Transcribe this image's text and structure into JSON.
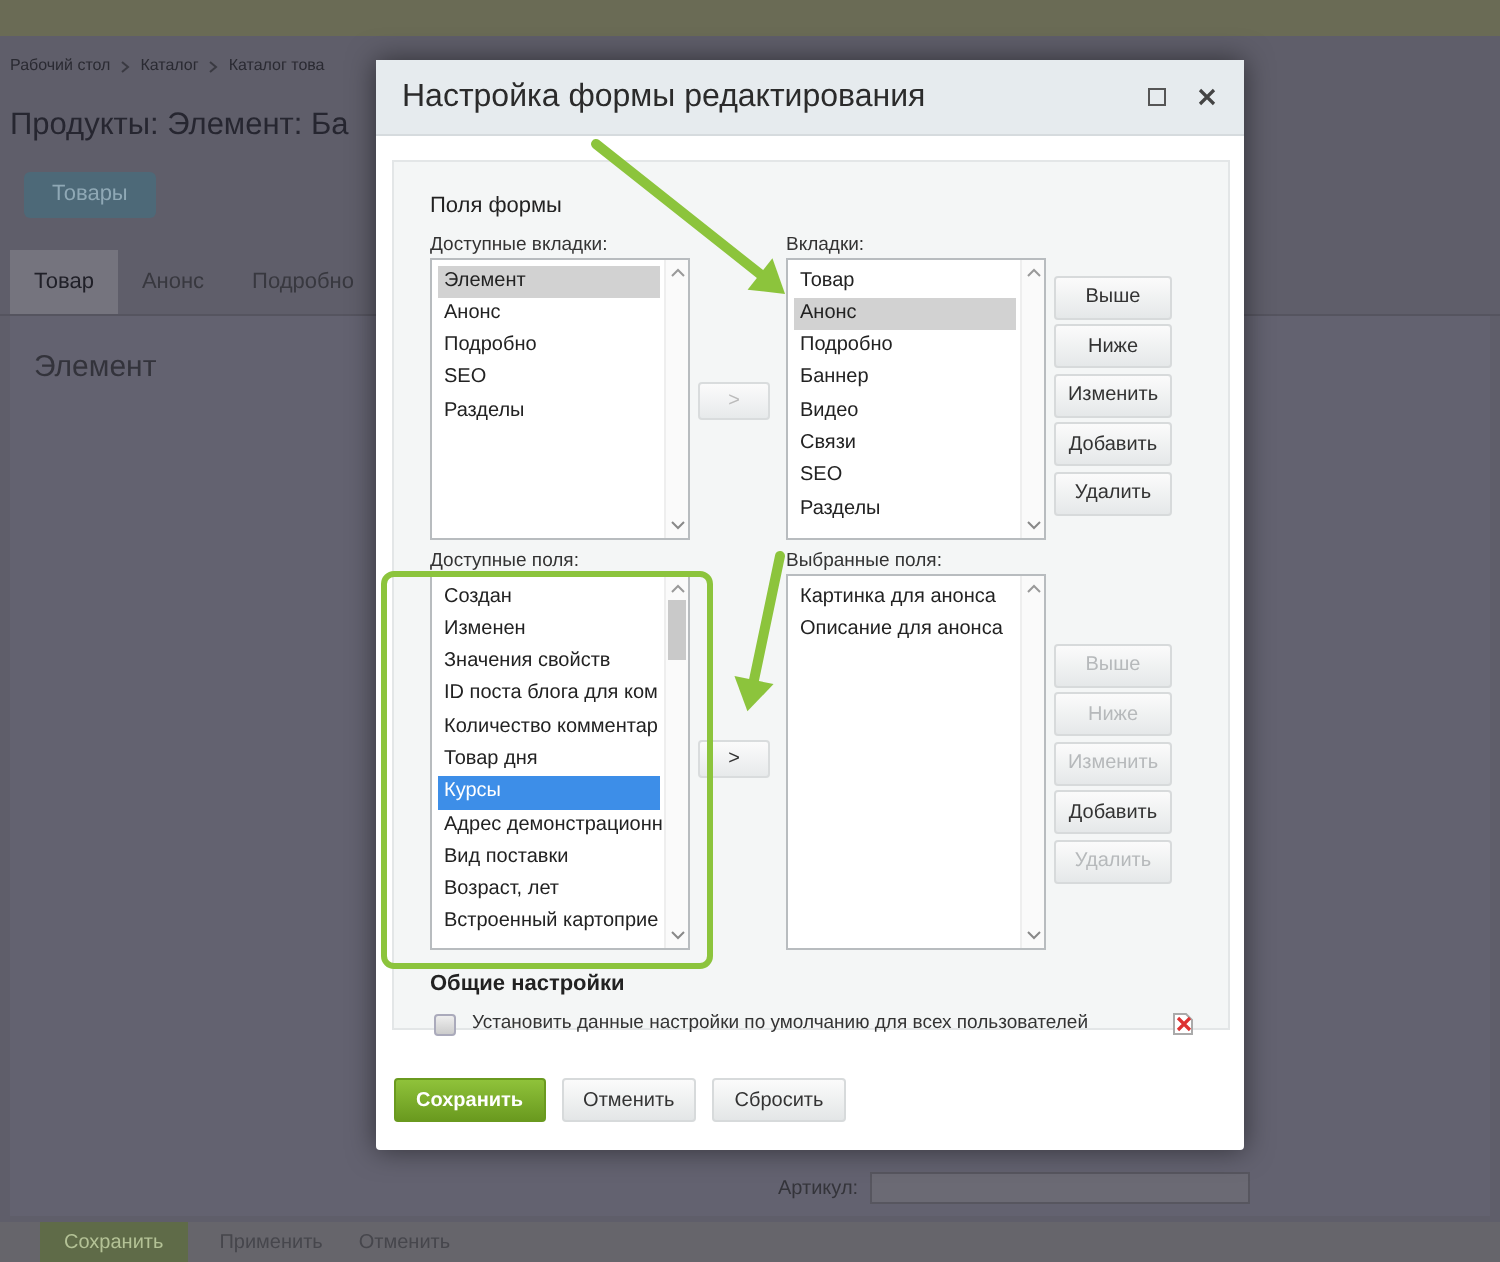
{
  "page": {
    "breadcrumbs": [
      "Рабочий стол",
      "Каталог",
      "Каталог това"
    ],
    "title": "Продукты: Элемент: Ба",
    "back_button": "Товары",
    "tabs": [
      {
        "label": "Товар",
        "selected": true
      },
      {
        "label": "Анонс",
        "selected": false
      },
      {
        "label": "Подробно",
        "selected": false
      }
    ],
    "section_title": "Элемент",
    "field_label": "Артикул:",
    "footer_buttons": [
      {
        "label": "Сохранить",
        "kind": "primary"
      },
      {
        "label": "Применить",
        "kind": "plain"
      },
      {
        "label": "Отменить",
        "kind": "plain"
      }
    ]
  },
  "dialog": {
    "title": "Настройка формы редактирования",
    "section_title": "Поля формы",
    "tab_lists": {
      "available_label": "Доступные вкладки:",
      "available": [
        {
          "label": "Элемент",
          "selected": true
        },
        {
          "label": "Анонс",
          "selected": false
        },
        {
          "label": "Подробно",
          "selected": false
        },
        {
          "label": "SEO",
          "selected": false
        },
        {
          "label": "Разделы",
          "selected": false
        }
      ],
      "move_button": {
        "label": ">",
        "disabled": true
      },
      "chosen_label": "Вкладки:",
      "chosen": [
        {
          "label": "Товар",
          "selected": false
        },
        {
          "label": "Анонс",
          "selected": true
        },
        {
          "label": "Подробно",
          "selected": false
        },
        {
          "label": "Баннер",
          "selected": false
        },
        {
          "label": "Видео",
          "selected": false
        },
        {
          "label": "Связи",
          "selected": false
        },
        {
          "label": "SEO",
          "selected": false
        },
        {
          "label": "Разделы",
          "selected": false
        }
      ],
      "buttons": [
        {
          "label": "Выше",
          "disabled": false
        },
        {
          "label": "Ниже",
          "disabled": false
        },
        {
          "label": "Изменить",
          "disabled": false
        },
        {
          "label": "Добавить",
          "disabled": false
        },
        {
          "label": "Удалить",
          "disabled": false
        }
      ]
    },
    "field_lists": {
      "available_label": "Доступные поля:",
      "available": [
        {
          "label": "Создан",
          "selected": false
        },
        {
          "label": "Изменен",
          "selected": false
        },
        {
          "label": "Значения свойств",
          "selected": false
        },
        {
          "label": "ID поста блога для ком",
          "selected": false
        },
        {
          "label": "Количество комментар",
          "selected": false
        },
        {
          "label": "Товар дня",
          "selected": false
        },
        {
          "label": "Курсы",
          "selected": true
        },
        {
          "label": "Адрес демонстрационн",
          "selected": false
        },
        {
          "label": "Вид поставки",
          "selected": false
        },
        {
          "label": "Возраст, лет",
          "selected": false
        },
        {
          "label": "Встроенный картоприе",
          "selected": false
        }
      ],
      "move_button": {
        "label": ">",
        "disabled": false
      },
      "chosen_label": "Выбранные поля:",
      "chosen": [
        {
          "label": "Картинка для анонса",
          "selected": false
        },
        {
          "label": "Описание для анонса",
          "selected": false
        }
      ],
      "buttons": [
        {
          "label": "Выше",
          "disabled": true
        },
        {
          "label": "Ниже",
          "disabled": true
        },
        {
          "label": "Изменить",
          "disabled": true
        },
        {
          "label": "Добавить",
          "disabled": false
        },
        {
          "label": "Удалить",
          "disabled": true
        }
      ]
    },
    "general_title": "Общие настройки",
    "default_checkbox": {
      "label": "Установить данные настройки по умолчанию для всех пользователей",
      "checked": false
    },
    "footer_buttons": [
      {
        "label": "Сохранить",
        "kind": "primary"
      },
      {
        "label": "Отменить",
        "kind": "plain"
      },
      {
        "label": "Сбросить",
        "kind": "plain"
      }
    ]
  },
  "annotations": [
    {
      "kind": "arrow"
    },
    {
      "kind": "arrow"
    },
    {
      "kind": "frame"
    }
  ]
}
